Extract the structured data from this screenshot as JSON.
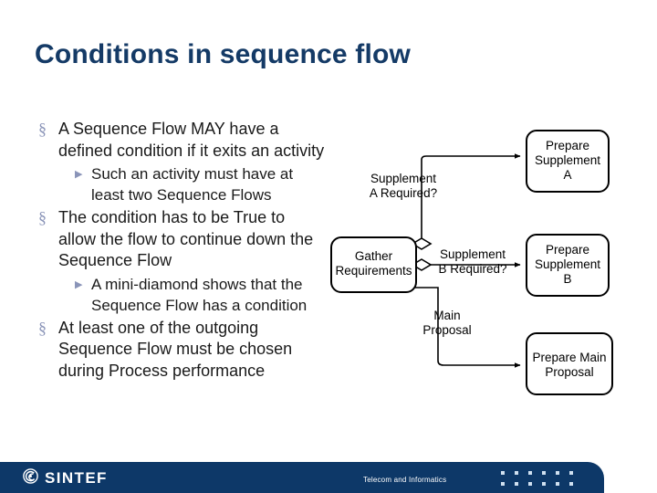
{
  "slide": {
    "title": "Conditions in sequence flow",
    "title_color": "#143a66",
    "background_color": "#ffffff"
  },
  "body": {
    "bullets": [
      {
        "level": 1,
        "marker": "§",
        "text": "A Sequence Flow MAY have a defined condition if it exits an activity"
      },
      {
        "level": 2,
        "marker": "▶",
        "text": "Such an activity must have at least two Sequence Flows"
      },
      {
        "level": 1,
        "marker": "§",
        "text": "The condition has to be True to allow the flow to continue down the Sequence Flow"
      },
      {
        "level": 2,
        "marker": "▶",
        "text": "A mini-diamond shows that the Sequence Flow has a condition"
      },
      {
        "level": 1,
        "marker": "§",
        "text": "At least one of the outgoing Sequence Flow must be chosen during Process performance"
      }
    ]
  },
  "diagram": {
    "tasks": [
      {
        "id": "gather",
        "label": "Gather\nRequirements",
        "line1": "Gather",
        "line2": "Requirements"
      },
      {
        "id": "prep-a",
        "label": "Prepare Supplement A",
        "line1": "Prepare",
        "line2": "Supplement",
        "line3": "A"
      },
      {
        "id": "prep-b",
        "label": "Prepare Supplement B",
        "line1": "Prepare",
        "line2": "Supplement",
        "line3": "B"
      },
      {
        "id": "prep-main",
        "label": "Prepare Main Proposal",
        "line1": "Prepare Main",
        "line2": "Proposal"
      }
    ],
    "flow_labels": [
      {
        "id": "cond-a",
        "line1": "Supplement",
        "line2": "A Required?"
      },
      {
        "id": "cond-b",
        "line1": "Supplement",
        "line2": "B Required?"
      },
      {
        "id": "cond-main",
        "line1": "Main",
        "line2": "Proposal"
      }
    ],
    "stroke_color": "#000000",
    "fill_color": "#ffffff"
  },
  "footer": {
    "brand": "SINTEF",
    "department": "Telecom and Informatics",
    "bar_color": "#0d3868",
    "dot_color": "#cfe0f0",
    "dot_rows": 2,
    "dot_cols": 6
  }
}
